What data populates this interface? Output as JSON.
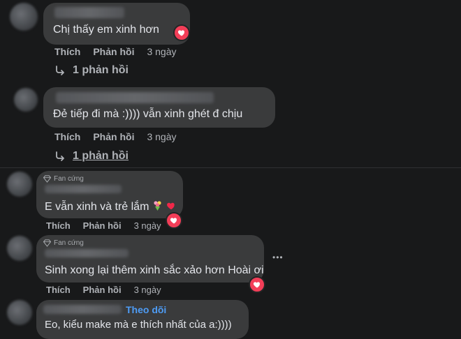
{
  "comments": [
    {
      "text": "Chị thấy em xinh hơn",
      "like": "Thích",
      "reply": "Phản hồi",
      "time": "3 ngày",
      "reply_count": "1 phản hồi",
      "reaction": "heart-icon"
    },
    {
      "text": "Đẻ tiếp đi mà :)))) vẫn xinh ghét đ chịu",
      "like": "Thích",
      "reply": "Phản hồi",
      "time": "3 ngày",
      "reply_count": "1 phản hồi"
    },
    {
      "badge": "Fan cứng",
      "text": "E vẫn xinh và trẻ lắm",
      "emojis": [
        "bouquet-icon",
        "red-heart-icon"
      ],
      "like": "Thích",
      "reply": "Phản hồi",
      "time": "3 ngày",
      "reaction": "heart-icon"
    },
    {
      "badge": "Fan cứng",
      "text": "Sinh xong lại thêm xinh sắc xảo hơn Hoài ơi",
      "like": "Thích",
      "reply": "Phản hồi",
      "time": "3 ngày",
      "reaction": "heart-icon"
    },
    {
      "follow": "Theo dõi",
      "text": "Eo, kiểu make mà e thích nhất của a:))))"
    }
  ],
  "more_options": "•••",
  "colors": {
    "background": "#18191a",
    "bubble": "#3a3b3c",
    "follow": "#4e9cf5",
    "love_reaction": "#f33e58"
  }
}
